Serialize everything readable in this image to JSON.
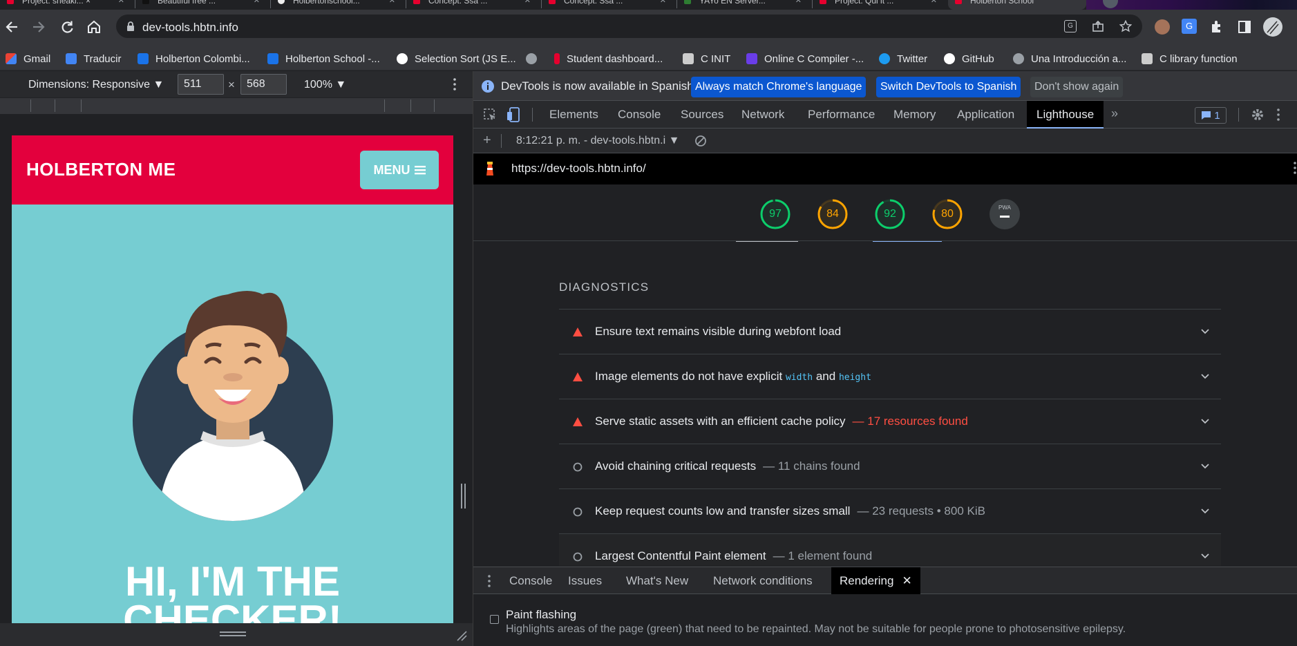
{
  "browser": {
    "tabs": [
      {
        "title": "Project: sneaki... ×"
      },
      {
        "title": "Beautiful free ..."
      },
      {
        "title": "Holbertonschool..."
      },
      {
        "title": "Concept: Ssa ..."
      },
      {
        "title": "Concept: Ssa ..."
      },
      {
        "title": "YAYo EN Server..."
      },
      {
        "title": "Project: Qui it ..."
      },
      {
        "title": "Holberton School"
      }
    ],
    "url": "dev-tools.hbtn.info",
    "bookmarks": [
      {
        "label": "Gmail"
      },
      {
        "label": "Traducir"
      },
      {
        "label": "Holberton Colombi..."
      },
      {
        "label": "Holberton School -..."
      },
      {
        "label": "Selection Sort (JS E..."
      },
      {
        "label": ""
      },
      {
        "label": "Student dashboard..."
      },
      {
        "label": "C INIT"
      },
      {
        "label": "Online C Compiler -..."
      },
      {
        "label": "Twitter"
      },
      {
        "label": "GitHub"
      },
      {
        "label": "Una Introducción a..."
      },
      {
        "label": "C library function"
      }
    ]
  },
  "device_toolbar": {
    "dimensions_label": "Dimensions: Responsive ▼",
    "width": "511",
    "times": "×",
    "height": "568",
    "zoom": "100% ▼"
  },
  "site": {
    "logo": "HOLBERTON ME",
    "menu_label": "MENU",
    "hero_title": "HI, I'M THE CHECKER!"
  },
  "devtools": {
    "infobar": {
      "message": "DevTools is now available in Spanish!",
      "btn_match": "Always match Chrome's language",
      "btn_switch": "Switch DevTools to Spanish",
      "btn_dismiss": "Don't show again"
    },
    "tabs": [
      "Elements",
      "Console",
      "Sources",
      "Network",
      "Performance",
      "Memory",
      "Application",
      "Lighthouse"
    ],
    "issues_count": "1",
    "report_label": "8:12:21 p. m. - dev-tools.hbtn.i ▼",
    "lighthouse_url": "https://dev-tools.hbtn.info/",
    "scores": [
      {
        "value": "97",
        "score": 0.97,
        "color": "#0cce6b"
      },
      {
        "value": "84",
        "score": 0.84,
        "color": "#ffa400"
      },
      {
        "value": "92",
        "score": 0.92,
        "color": "#0cce6b"
      },
      {
        "value": "80",
        "score": 0.8,
        "color": "#ffa400"
      },
      {
        "value": "PWA",
        "score": 0,
        "color": "#9aa0a6"
      }
    ],
    "diagnostics_title": "DIAGNOSTICS",
    "audits": [
      {
        "type": "fail",
        "title": "Ensure text remains visible during webfont load",
        "extra": ""
      },
      {
        "type": "fail",
        "title_pre": "Image elements do not have explicit",
        "code1": "width",
        "and": "and",
        "code2": "height"
      },
      {
        "type": "fail",
        "title": "Serve static assets with an efficient cache policy",
        "extra": "— 17 resources found"
      },
      {
        "type": "info",
        "title": "Avoid chaining critical requests",
        "extra": "— 11 chains found"
      },
      {
        "type": "info",
        "title": "Keep request counts low and transfer sizes small",
        "extra": "— 23 requests • 800 KiB"
      },
      {
        "type": "info",
        "title": "Largest Contentful Paint element",
        "extra": "— 1 element found"
      }
    ],
    "drawer": {
      "tabs": [
        "Console",
        "Issues",
        "What's New",
        "Network conditions",
        "Rendering"
      ],
      "paint_flashing_label": "Paint flashing",
      "paint_flashing_desc": "Highlights areas of the page (green) that need to be repainted. May not be suitable for people prone to photosensitive epilepsy."
    }
  },
  "colors": {
    "brand_red": "#e3003d",
    "brand_teal": "#76cdd2",
    "devtools_blue": "#0b57d0"
  }
}
